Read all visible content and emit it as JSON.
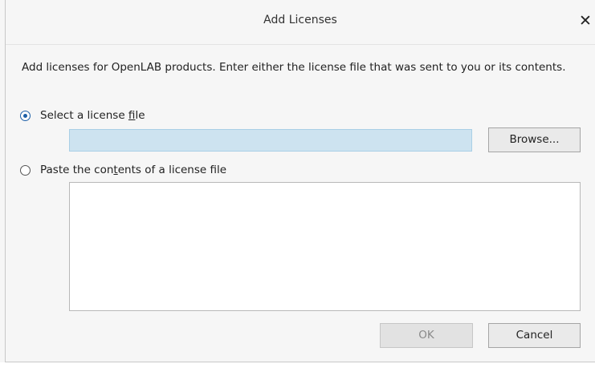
{
  "dialog": {
    "title": "Add Licenses",
    "close_glyph": "✕",
    "close_icon": "close-icon",
    "description": "Add licenses for OpenLAB products. Enter either the license file that was sent to you or its contents.",
    "options": [
      {
        "label_before": "Select a license ",
        "label_access": "f",
        "label_after": "ile",
        "selected": true
      },
      {
        "label_before": "Paste the con",
        "label_access": "t",
        "label_after": "ents of a license file",
        "selected": false
      }
    ],
    "file_input": {
      "value": "",
      "placeholder": ""
    },
    "browse_label": "Browse...",
    "paste_contents": "",
    "ok_label": "OK",
    "cancel_label": "Cancel",
    "ok_enabled": false
  },
  "colors": {
    "background": "#f6f6f6",
    "input_fill": "#cde3f0",
    "radio_accent": "#1d5fa7",
    "button_fill": "#eaeaea",
    "disabled_text": "#8a8a8a"
  }
}
